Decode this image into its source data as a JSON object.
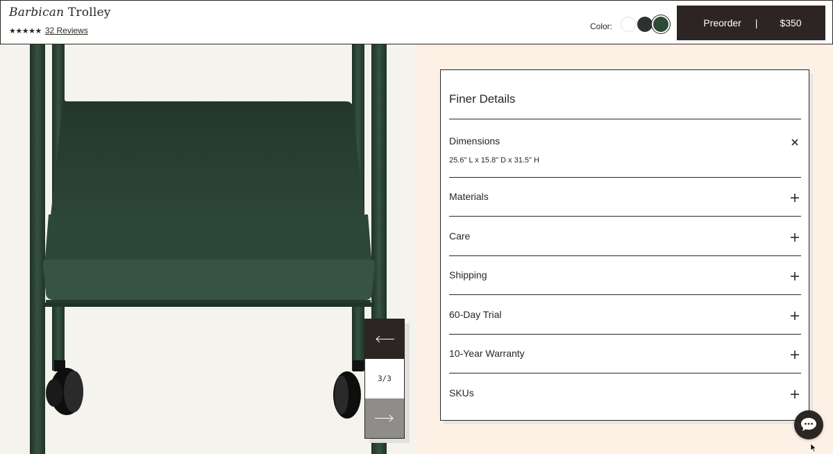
{
  "product": {
    "title_italic": "Barbican",
    "title_regular": "Trolley",
    "stars": "★★★★★",
    "rating_value": 5,
    "reviews_label": "32 Reviews"
  },
  "color_picker": {
    "label": "Color:",
    "swatches": [
      {
        "name": "white",
        "hex": "#ffffff"
      },
      {
        "name": "charcoal",
        "hex": "#2f3032"
      },
      {
        "name": "green",
        "hex": "#2e4a38",
        "selected": true
      }
    ]
  },
  "cta": {
    "label": "Preorder",
    "separator": "|",
    "price": "$350",
    "background": "#2c2523"
  },
  "gallery": {
    "counter": "3/3",
    "prev_icon": "arrow-left-icon",
    "next_icon": "arrow-right-icon"
  },
  "details": {
    "title": "Finer Details",
    "items": [
      {
        "label": "Dimensions",
        "expanded": true,
        "body": "25.6\" L x 15.8\" D x 31.5\" H",
        "icon": "close-icon"
      },
      {
        "label": "Materials",
        "expanded": false,
        "icon": "plus-icon"
      },
      {
        "label": "Care",
        "expanded": false,
        "icon": "plus-icon"
      },
      {
        "label": "Shipping",
        "expanded": false,
        "icon": "plus-icon"
      },
      {
        "label": "60-Day Trial",
        "expanded": false,
        "icon": "plus-icon"
      },
      {
        "label": "10-Year Warranty",
        "expanded": false,
        "icon": "plus-icon"
      },
      {
        "label": "SKUs",
        "expanded": false,
        "icon": "plus-icon"
      }
    ]
  },
  "chat": {
    "icon": "chat-bubble-icon"
  },
  "colors": {
    "accent_dark": "#2c2523",
    "panel_bg": "#fdf1e6",
    "image_bg": "#f5f3ee",
    "product_green": "#2e4a38"
  }
}
